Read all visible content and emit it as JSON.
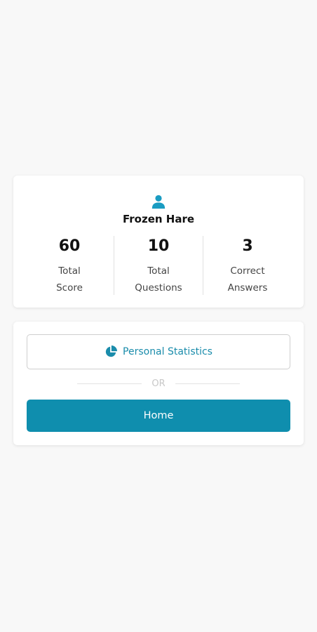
{
  "profile": {
    "name": "Frozen Hare",
    "icon": "user-icon",
    "stats": [
      {
        "value": "60",
        "label_line1": "Total",
        "label_line2": "Score"
      },
      {
        "value": "10",
        "label_line1": "Total",
        "label_line2": "Questions"
      },
      {
        "value": "3",
        "label_line1": "Correct",
        "label_line2": "Answers"
      }
    ]
  },
  "actions": {
    "personal_stats_label": "Personal Statistics",
    "personal_stats_icon": "pie-chart-icon",
    "or_text": "OR",
    "home_label": "Home"
  },
  "colors": {
    "accent": "#0f8eae",
    "accent_text": "#1a8cab",
    "background": "#f8f8f8"
  }
}
